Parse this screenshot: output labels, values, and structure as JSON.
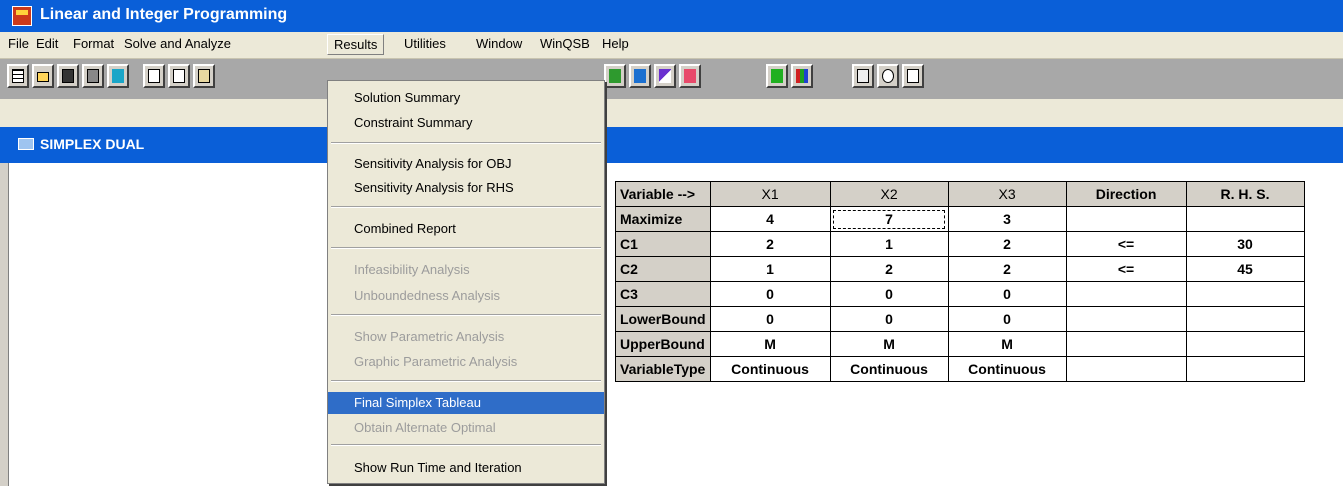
{
  "window": {
    "title": "Linear and Integer Programming"
  },
  "menubar": {
    "items": [
      "File",
      "Edit",
      "Format",
      "Solve and Analyze",
      "Results",
      "Utilities",
      "Window",
      "WinQSB",
      "Help"
    ]
  },
  "toolbar": {
    "buttons": [
      "new-icon",
      "open-icon",
      "save-icon",
      "print-icon",
      "exit-icon",
      "cut-icon",
      "copy-icon",
      "paste-icon",
      "solve-icon",
      "bar-icon",
      "slope-icon",
      "range-icon",
      "bars-icon",
      "histogram-icon",
      "calculator-icon",
      "clock-icon",
      "help-icon"
    ]
  },
  "subwindow": {
    "title": "SIMPLEX DUAL"
  },
  "results_menu": {
    "items": [
      {
        "label": "Solution Summary",
        "enabled": true
      },
      {
        "label": "Constraint Summary",
        "enabled": true
      },
      {
        "label": "Sensitivity Analysis for OBJ",
        "enabled": true
      },
      {
        "label": "Sensitivity Analysis for RHS",
        "enabled": true
      },
      {
        "label": "Combined Report",
        "enabled": true
      },
      {
        "label": "Infeasibility Analysis",
        "enabled": false
      },
      {
        "label": "Unboundedness Analysis",
        "enabled": false
      },
      {
        "label": "Show Parametric Analysis",
        "enabled": false
      },
      {
        "label": "Graphic Parametric Analysis",
        "enabled": false
      },
      {
        "label": "Final Simplex Tableau",
        "enabled": true,
        "highlighted": true
      },
      {
        "label": "Obtain Alternate Optimal",
        "enabled": false
      },
      {
        "label": "Show Run Time and Iteration",
        "enabled": true
      }
    ]
  },
  "table": {
    "headers": [
      "Variable -->",
      "X1",
      "X2",
      "X3",
      "Direction",
      "R. H. S."
    ],
    "rows": [
      [
        "Maximize",
        "4",
        "7",
        "3",
        "",
        ""
      ],
      [
        "C1",
        "2",
        "1",
        "2",
        "<=",
        "30"
      ],
      [
        "C2",
        "1",
        "2",
        "2",
        "<=",
        "45"
      ],
      [
        "C3",
        "0",
        "0",
        "0",
        "",
        ""
      ],
      [
        "LowerBound",
        "0",
        "0",
        "0",
        "",
        ""
      ],
      [
        "UpperBound",
        "M",
        "M",
        "M",
        "",
        ""
      ],
      [
        "VariableType",
        "Continuous",
        "Continuous",
        "Continuous",
        "",
        ""
      ]
    ]
  },
  "colors": {
    "titlebar": "#0a5fd8",
    "menu_highlight": "#2f6dc8",
    "toolbar": "#a8a8a8"
  }
}
